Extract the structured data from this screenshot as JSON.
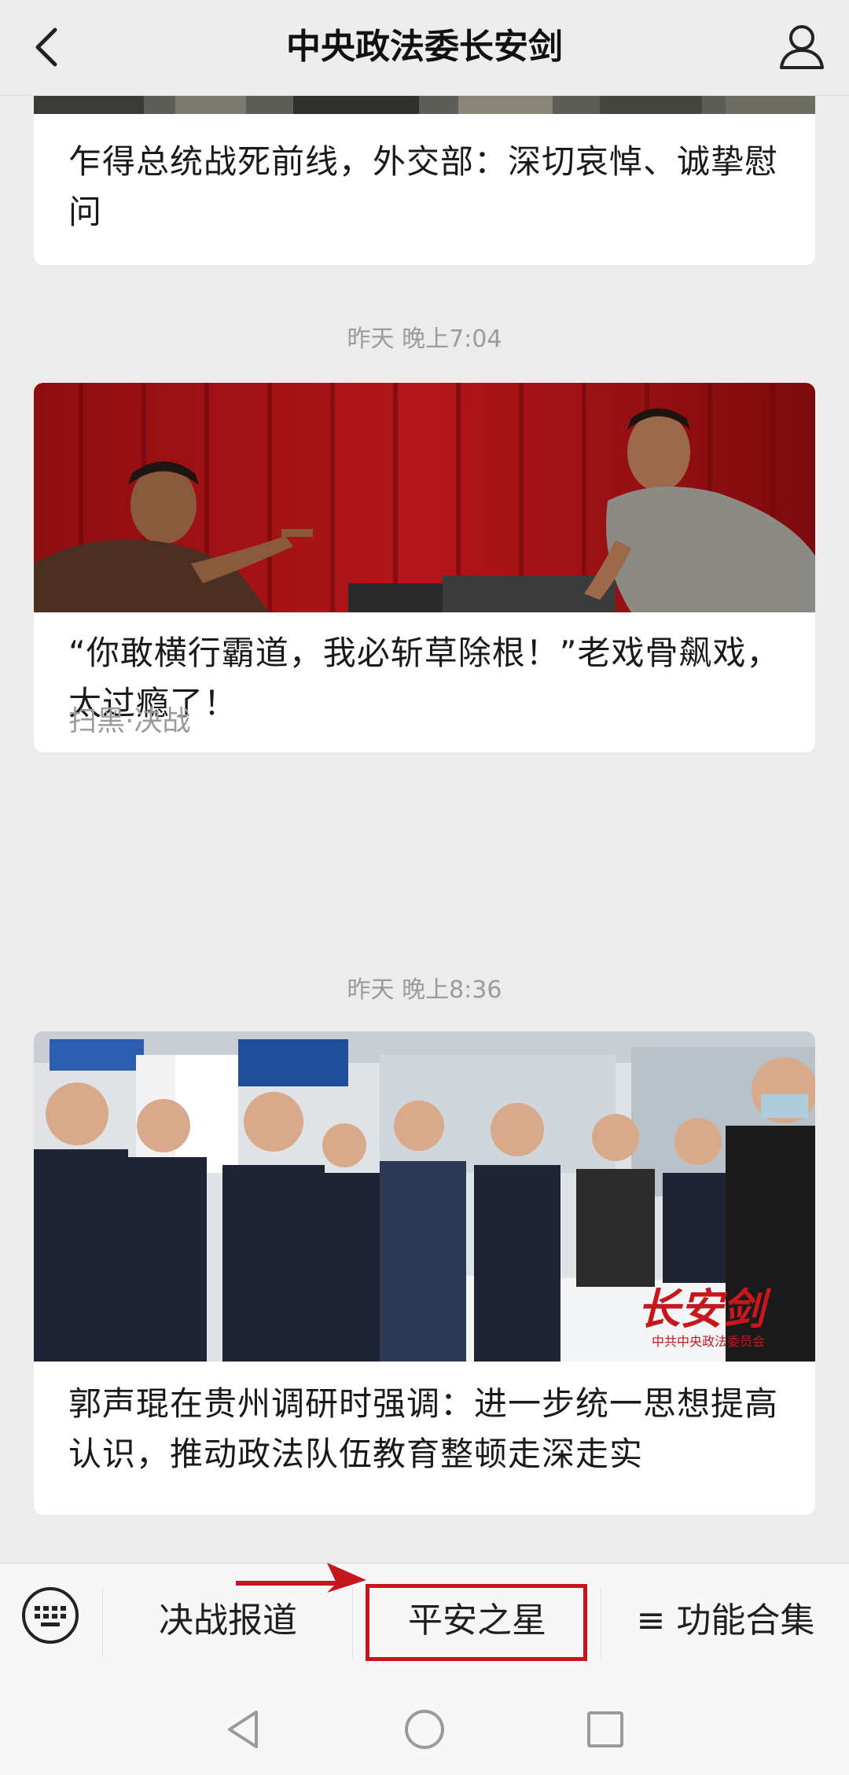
{
  "header": {
    "title": "中央政法委长安剑"
  },
  "feed": {
    "items": [
      {
        "title": "乍得总统战死前线，外交部：深切哀悼、诚挚慰问"
      },
      {
        "timestamp": "昨天 晚上7:04",
        "title": "“你敢横行霸道，我必斩草除根！”老戏骨飙戏，太过瘾了！",
        "source": "扫黑·决战"
      },
      {
        "timestamp": "昨天 晚上8:36",
        "title": "郭声琨在贵州调研时强调：进一步统一思想提高认识，推动政法队伍教育整顿走深走实",
        "watermark": "长安剑",
        "watermark_sub": "中共中央政法委员会"
      }
    ]
  },
  "menu": {
    "items": [
      {
        "label": "决战报道"
      },
      {
        "label": "平安之星"
      },
      {
        "label": "≡ 功能合集"
      }
    ]
  },
  "icons": {
    "back": "chevron-left-icon",
    "profile": "user-icon",
    "keyboard": "keyboard-icon",
    "sys_back": "triangle-back-icon",
    "sys_home": "circle-home-icon",
    "sys_recent": "square-recent-icon"
  },
  "colors": {
    "highlight": "#c4161c",
    "background": "#ececec"
  }
}
